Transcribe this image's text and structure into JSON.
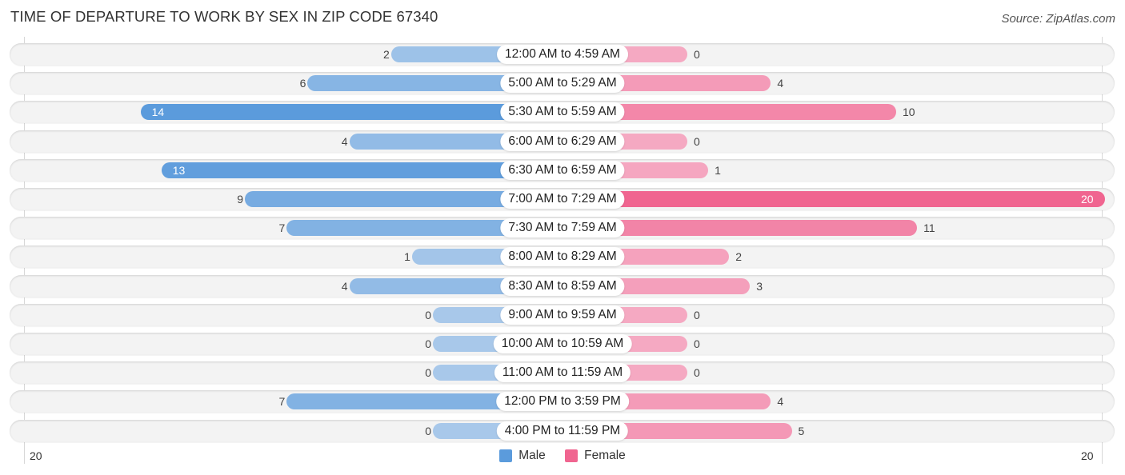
{
  "title": "TIME OF DEPARTURE TO WORK BY SEX IN ZIP CODE 67340",
  "source": "Source: ZipAtlas.com",
  "colors": {
    "male": "#5b9bdc",
    "male_light": "#a8c8ea",
    "female": "#f06590",
    "female_light": "#f5a9c2",
    "row_bg": "#f3f3f3"
  },
  "axis": {
    "left_label": "20",
    "right_label": "20"
  },
  "legend": [
    {
      "label": "Male",
      "color": "#5b9bdc"
    },
    {
      "label": "Female",
      "color": "#f06590"
    }
  ],
  "chart_data": {
    "type": "bar",
    "orientation": "horizontal-diverging",
    "title": "TIME OF DEPARTURE TO WORK BY SEX IN ZIP CODE 67340",
    "categories": [
      "12:00 AM to 4:59 AM",
      "5:00 AM to 5:29 AM",
      "5:30 AM to 5:59 AM",
      "6:00 AM to 6:29 AM",
      "6:30 AM to 6:59 AM",
      "7:00 AM to 7:29 AM",
      "7:30 AM to 7:59 AM",
      "8:00 AM to 8:29 AM",
      "8:30 AM to 8:59 AM",
      "9:00 AM to 9:59 AM",
      "10:00 AM to 10:59 AM",
      "11:00 AM to 11:59 AM",
      "12:00 PM to 3:59 PM",
      "4:00 PM to 11:59 PM"
    ],
    "series": [
      {
        "name": "Male",
        "values": [
          2,
          6,
          14,
          4,
          13,
          9,
          7,
          1,
          4,
          0,
          0,
          0,
          7,
          0
        ]
      },
      {
        "name": "Female",
        "values": [
          0,
          4,
          10,
          0,
          1,
          20,
          11,
          2,
          3,
          0,
          0,
          0,
          4,
          5
        ]
      }
    ],
    "xlim": [
      20,
      20
    ],
    "xlabel": "",
    "ylabel": "",
    "legend_position": "bottom-center",
    "grid": false
  }
}
